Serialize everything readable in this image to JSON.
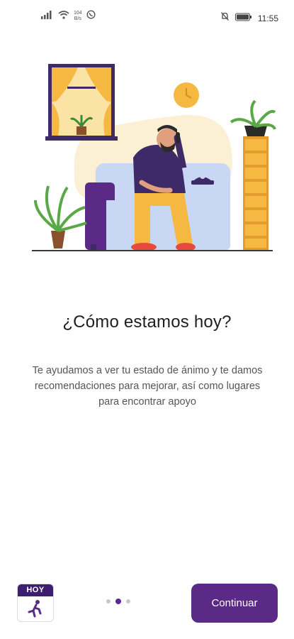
{
  "status_bar": {
    "time": "11:55",
    "net_speed_value": "104",
    "net_speed_unit": "B/s",
    "icons": [
      "signal-icon",
      "wifi-icon",
      "whatsapp-icon",
      "mute-icon",
      "battery-icon"
    ]
  },
  "illustration": {
    "name": "man-on-phone-on-sofa-illustration"
  },
  "onboarding": {
    "title": "¿Cómo estamos hoy?",
    "description": "Te ayudamos a ver tu estado de ánimo y te damos recomendaciones para mejorar, así como lugares para encontrar apoyo"
  },
  "footer": {
    "logo_text": "HOY",
    "page_indicator": {
      "total": 3,
      "active": 2
    },
    "continue_label": "Continuar"
  },
  "colors": {
    "primary": "#5b2a86",
    "accent_yellow": "#f5b942",
    "text_dark": "#1f1f1f",
    "text_muted": "#555555"
  }
}
